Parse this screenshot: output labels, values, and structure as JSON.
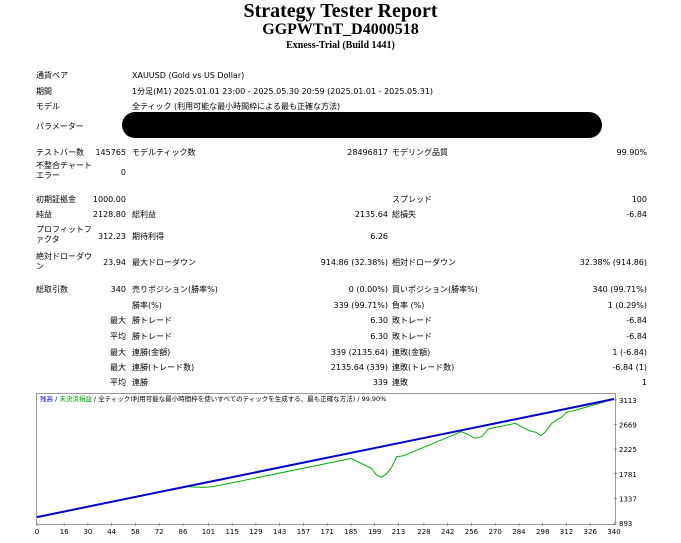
{
  "header": {
    "title": "Strategy Tester Report",
    "subtitle": "GGPWTnT_D4000518",
    "build": "Exness-Trial (Build 1441)"
  },
  "settings": {
    "symbol_label": "通貨ペア",
    "symbol_value": "XAUUSD (Gold vs US Dollar)",
    "period_label": "期間",
    "period_value": "1分足(M1) 2025.01.01 23:00 - 2025.05.30 20:59 (2025.01.01 - 2025.05.31)",
    "model_label": "モデル",
    "model_value": "全ティック (利用可能な最小時間枠による最も正確な方法)",
    "params_label": "パラメーター",
    "params_value": "(redacted)"
  },
  "stats": {
    "bars_label": "テストバー数",
    "bars_value": "145765",
    "ticks_label": "モデルティック数",
    "ticks_value": "28496817",
    "quality_label": "モデリング品質",
    "quality_value": "99.90%",
    "mismatch_label": "不整合チャートエラー",
    "mismatch_value": "0",
    "deposit_label": "初期証拠金",
    "deposit_value": "1000.00",
    "spread_label": "スプレッド",
    "spread_value": "100",
    "net_label": "純益",
    "net_value": "2128.80",
    "gross_profit_label": "総利益",
    "gross_profit_value": "2135.64",
    "gross_loss_label": "総損失",
    "gross_loss_value": "-6.84",
    "pf_label": "プロフィットファクタ",
    "pf_value": "312.23",
    "payoff_label": "期待利得",
    "payoff_value": "6.26",
    "abs_dd_label": "絶対ドローダウン",
    "abs_dd_value": "23.94",
    "max_dd_label": "最大ドローダウン",
    "max_dd_value": "914.86 (32.38%)",
    "rel_dd_label": "相対ドローダウン",
    "rel_dd_value": "32.38% (914.86)",
    "trades_label": "総取引数",
    "trades_value": "340",
    "short_label": "売りポジション(勝率%)",
    "short_value": "0 (0.00%)",
    "long_label": "買いポジション(勝率%)",
    "long_value": "340 (99.71%)",
    "win_label": "勝率(%)",
    "win_value": "339 (99.71%)",
    "loss_label": "負率 (%)",
    "loss_value": "1 (0.29%)",
    "max_prefix": "最大",
    "avg_prefix": "平均",
    "win_trade_label": "勝トレード",
    "loss_trade_label": "敗トレード",
    "max_win_value": "6.30",
    "max_loss_value": "-6.84",
    "avg_win_value": "6.30",
    "avg_loss_value": "-6.84",
    "consec_win_amt_label": "連勝(金額)",
    "consec_win_amt_value": "339 (2135.64)",
    "consec_loss_amt_label": "連敗(金額)",
    "consec_loss_amt_value": "1 (-6.84)",
    "consec_win_cnt_label": "連勝(トレード数)",
    "consec_win_cnt_value": "2135.64 (339)",
    "consec_loss_cnt_label": "連敗(トレード数)",
    "consec_loss_cnt_value": "-6.84 (1)",
    "avg_consec_win_label": "連勝",
    "avg_consec_win_value": "339",
    "avg_consec_loss_label": "連敗",
    "avg_consec_loss_value": "1"
  },
  "chart_legend": {
    "balance": "残高",
    "sep1": " / ",
    "equity": "未決済損益",
    "sep2": " / ",
    "model": "全ティック(利用可能な最小時間枠を使いすべてのティックを生成する、最も正確な方法)",
    "sep3": " / ",
    "quality": "99.90%"
  },
  "chart_data": {
    "type": "line",
    "x_ticks": [
      0,
      16,
      30,
      44,
      58,
      72,
      86,
      101,
      115,
      129,
      143,
      157,
      171,
      185,
      199,
      213,
      228,
      242,
      256,
      270,
      284,
      298,
      312,
      326,
      340
    ],
    "y_ticks": [
      893,
      1337,
      1781,
      2225,
      2669,
      3113
    ],
    "xlim": [
      0,
      340
    ],
    "ylim": [
      893,
      3220
    ],
    "series": [
      {
        "color": "#0000c8",
        "x": [
          0,
          50,
          100,
          150,
          200,
          250,
          300,
          340
        ],
        "y": [
          1000,
          1313,
          1626,
          1939,
          2252,
          2565,
          2878,
          3129
        ]
      },
      {
        "color": "#00b000",
        "x": [
          0,
          88,
          94,
          98,
          104,
          110,
          185,
          189,
          193,
          197,
          200,
          203,
          206,
          209,
          212,
          216,
          250,
          254,
          258,
          262,
          266,
          282,
          286,
          290,
          294,
          297,
          300,
          303,
          306,
          309,
          312,
          316,
          340
        ],
        "y": [
          1000,
          1551,
          1540,
          1535,
          1551,
          1588,
          2057,
          2000,
          1940,
          1880,
          1760,
          1720,
          1780,
          1900,
          2090,
          2107,
          2540,
          2490,
          2420,
          2450,
          2591,
          2691,
          2620,
          2560,
          2530,
          2470,
          2550,
          2680,
          2750,
          2800,
          2891,
          2916,
          3129
        ]
      }
    ]
  }
}
